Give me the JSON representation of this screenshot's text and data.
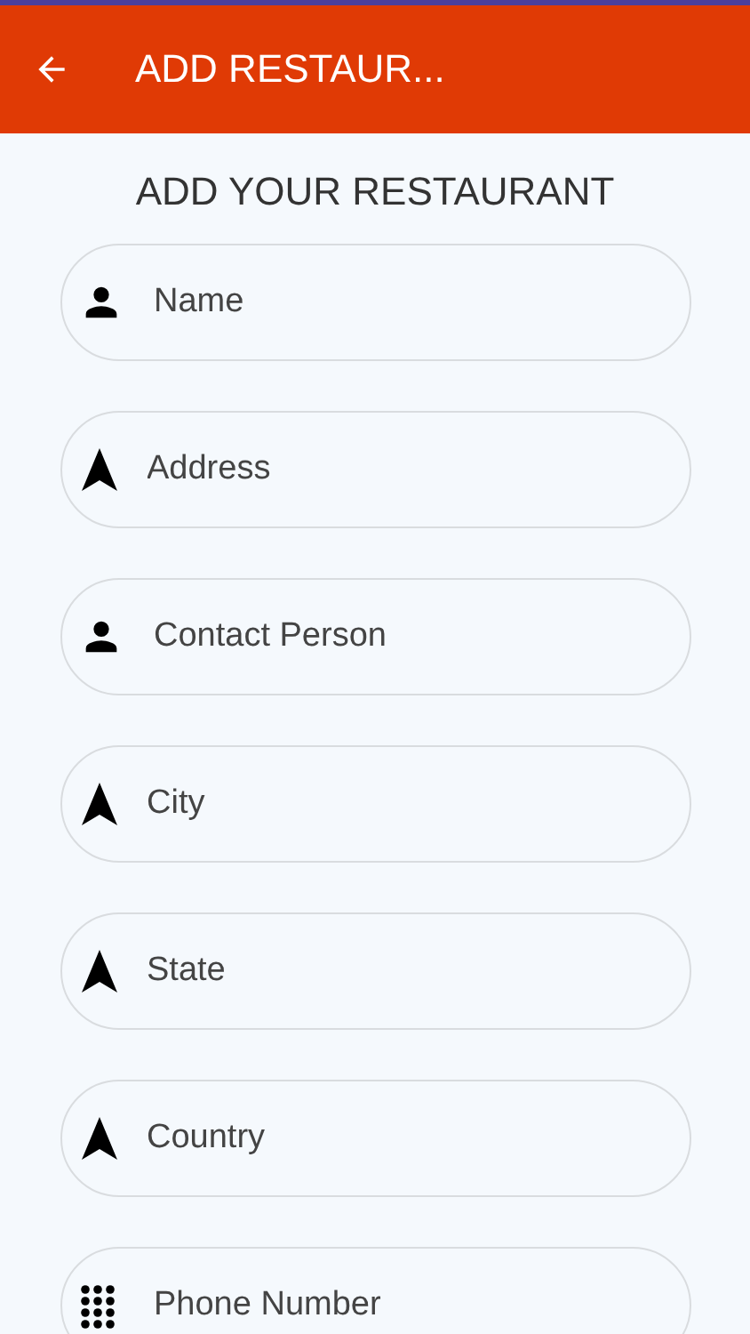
{
  "app_bar": {
    "title": "ADD RESTAUR..."
  },
  "heading": "ADD YOUR RESTAURANT",
  "fields": [
    {
      "kind": "person",
      "placeholder": "Name"
    },
    {
      "kind": "navigation",
      "placeholder": "Address"
    },
    {
      "kind": "person",
      "placeholder": "Contact Person"
    },
    {
      "kind": "navigation",
      "placeholder": "City"
    },
    {
      "kind": "navigation",
      "placeholder": "State"
    },
    {
      "kind": "navigation",
      "placeholder": "Country"
    },
    {
      "kind": "dialpad",
      "placeholder": "Phone Number"
    }
  ]
}
